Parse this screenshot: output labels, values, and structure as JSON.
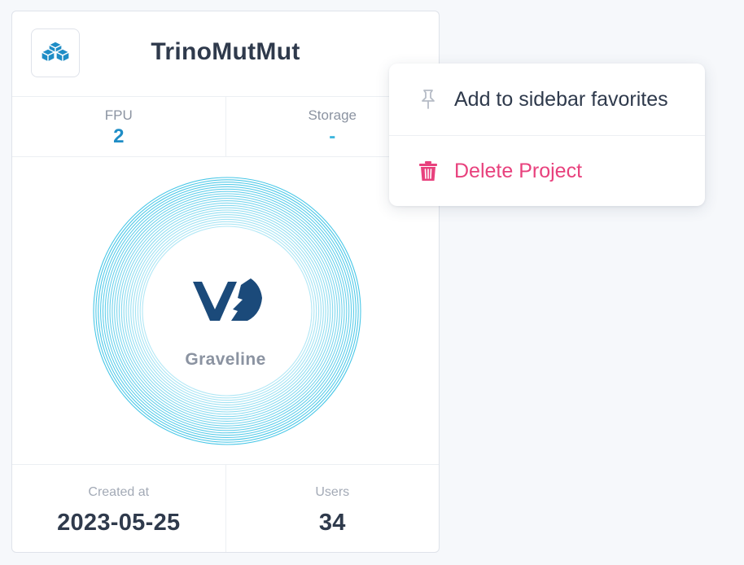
{
  "card": {
    "title": "TrinoMutMut",
    "logo_icon": "cubes-icon",
    "stats": [
      {
        "label": "FPU",
        "value": "2"
      },
      {
        "label": "Storage",
        "value": "-"
      }
    ],
    "region": {
      "name": "Graveline",
      "logo_icon": "ovh-logo-icon"
    },
    "footer": [
      {
        "label": "Created at",
        "value": "2023-05-25"
      },
      {
        "label": "Users",
        "value": "34"
      }
    ]
  },
  "context_menu": {
    "items": [
      {
        "label": "Add to sidebar favorites",
        "icon": "pin-icon"
      },
      {
        "label": "Delete Project",
        "icon": "trash-icon"
      }
    ]
  },
  "colors": {
    "accent": "#1f8dc6",
    "ring": "#3fc4e6",
    "danger": "#e8417d",
    "logo_navy": "#1b4a7a",
    "text_dark": "#2f3a4c",
    "text_muted": "#8b93a1"
  }
}
